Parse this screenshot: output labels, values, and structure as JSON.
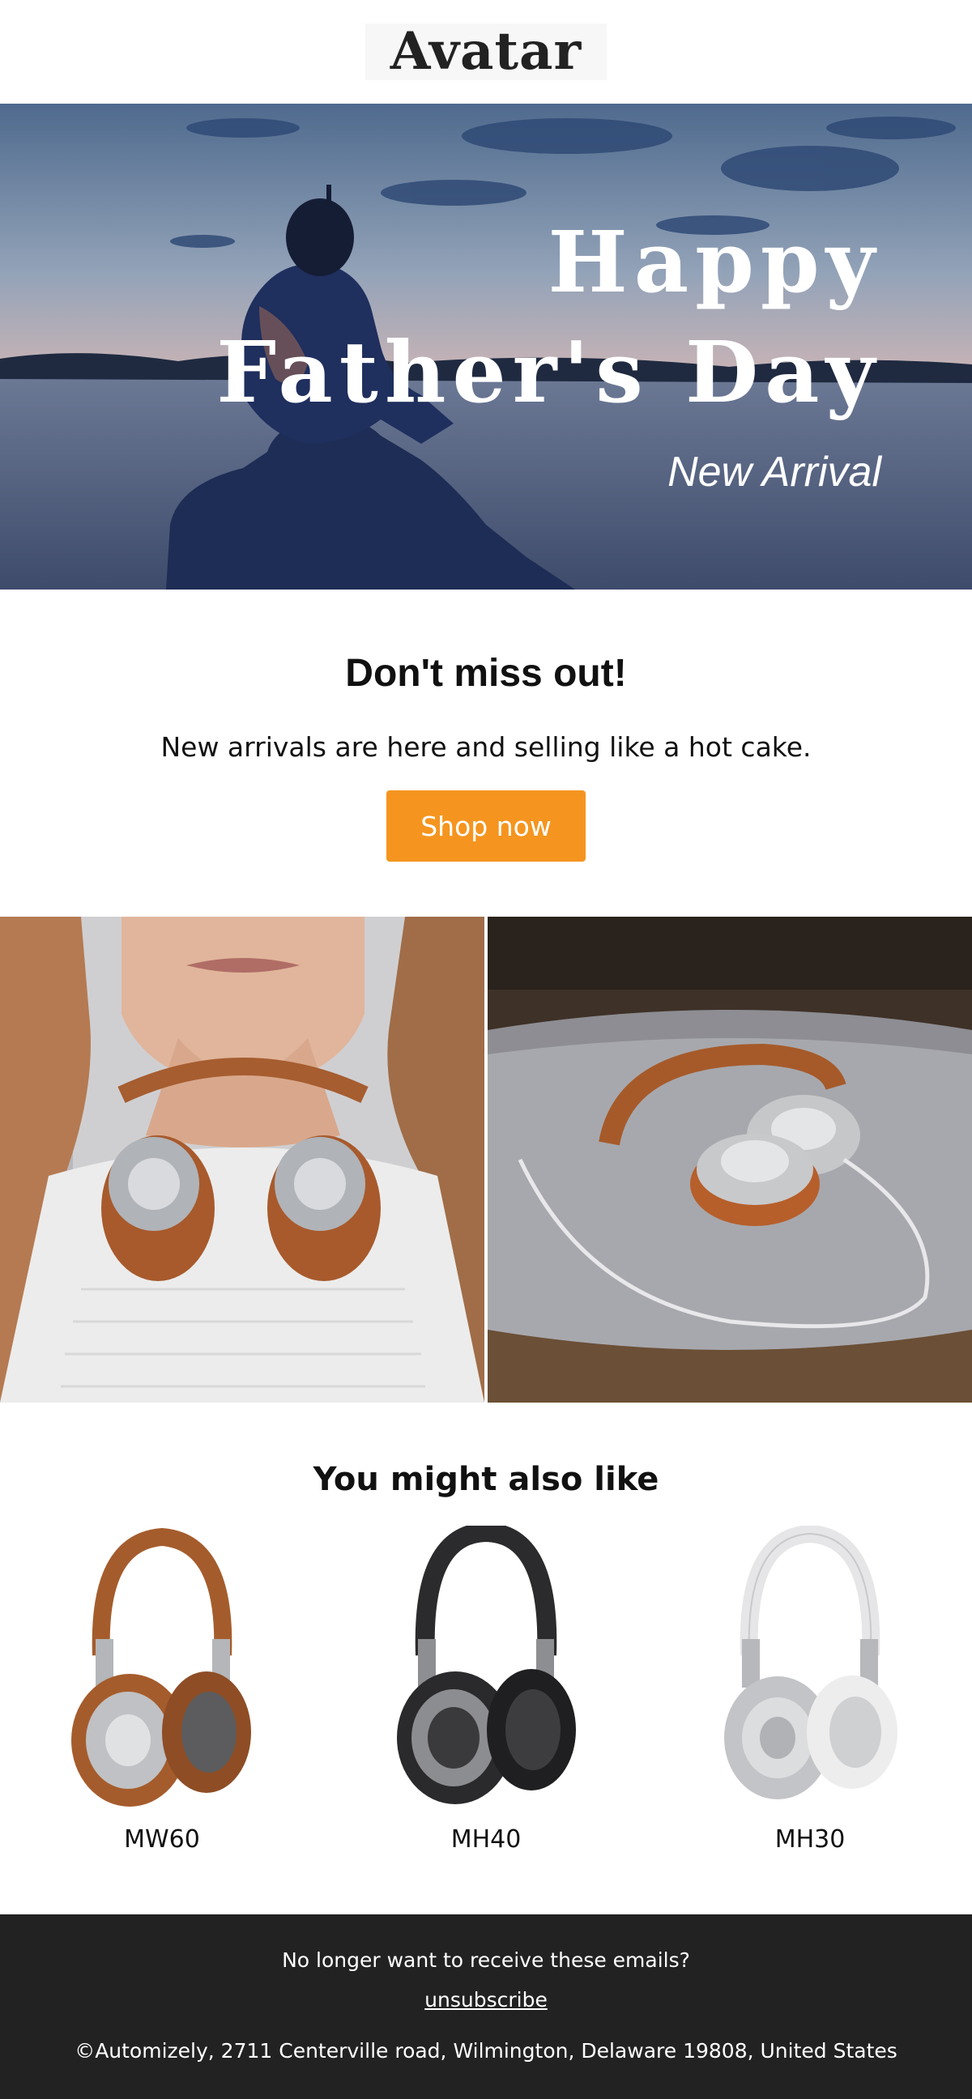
{
  "header": {
    "logo_text": "Avatar"
  },
  "hero": {
    "title_line1": "Happy",
    "title_line2": "Father's Day",
    "subtitle": "New Arrival"
  },
  "promo": {
    "heading": "Don't miss out!",
    "text": "New arrivals are here and selling like a hot cake.",
    "button_label": "Shop now",
    "button_color": "#f5951f"
  },
  "recommendations": {
    "heading": "You might also like",
    "products": [
      {
        "name": "MW60",
        "color": "brown"
      },
      {
        "name": "MH40",
        "color": "black"
      },
      {
        "name": "MH30",
        "color": "white"
      }
    ]
  },
  "footer": {
    "message": "No longer want to receive these emails?",
    "unsubscribe_label": "unsubscribe",
    "address": "©Automizely, 2711 Centerville road, Wilmington, Delaware 19808, United States",
    "background": "#222222"
  }
}
